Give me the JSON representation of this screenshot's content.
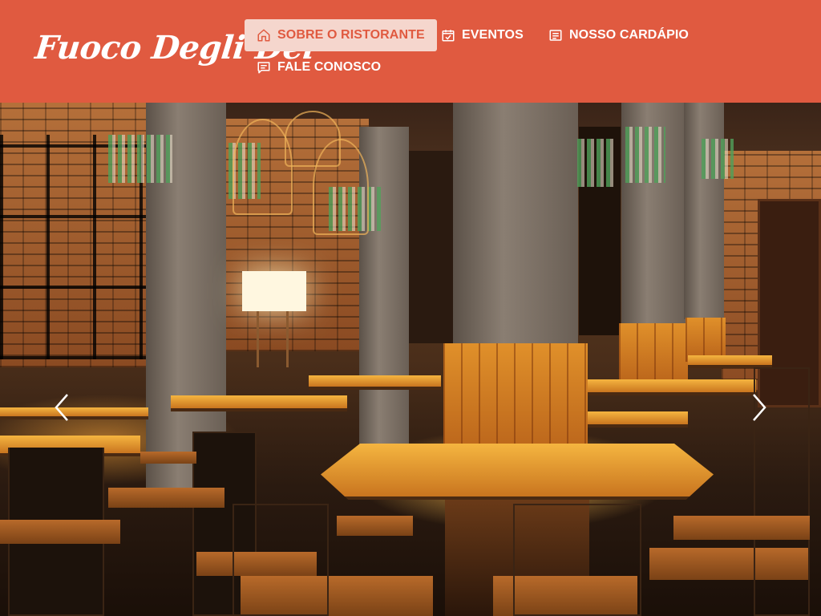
{
  "brand": {
    "name": "Fuoco Degli Dei"
  },
  "nav": {
    "items": [
      {
        "label": "SOBRE O RISTORANTE",
        "icon": "home-icon",
        "active": true
      },
      {
        "label": "EVENTOS",
        "icon": "calendar-check-icon",
        "active": false
      },
      {
        "label": "NOSSO CARDÁPIO",
        "icon": "menu-list-icon",
        "active": false
      },
      {
        "label": "FALE CONOSCO",
        "icon": "chat-icon",
        "active": false
      }
    ]
  },
  "carousel": {
    "prev_icon": "chevron-left-icon",
    "next_icon": "chevron-right-icon"
  },
  "colors": {
    "header_bg": "#e05a40",
    "active_nav_bg": "#f5d6cd",
    "text": "#ffffff"
  }
}
